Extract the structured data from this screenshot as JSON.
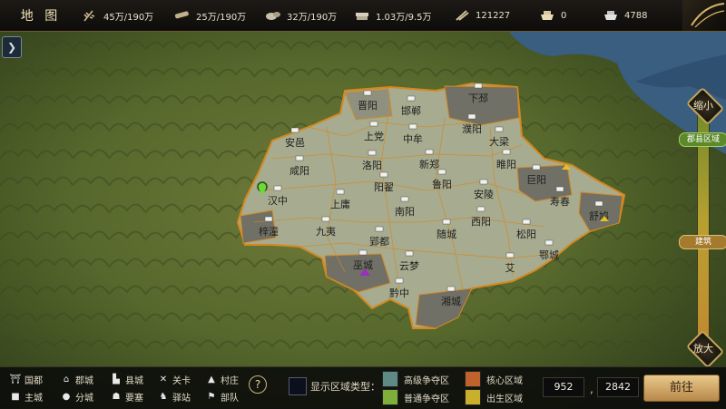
{
  "topbar": {
    "title": "地 图",
    "resources": [
      {
        "icon": "wheat-icon",
        "value": "45万/190万"
      },
      {
        "icon": "wood-icon",
        "value": "25万/190万"
      },
      {
        "icon": "stone-icon",
        "value": "32万/190万"
      },
      {
        "icon": "iron-icon",
        "value": "1.03万/9.5万"
      },
      {
        "icon": "copper-coin-icon",
        "value": "121227"
      },
      {
        "icon": "gold-ingot-icon",
        "value": "0"
      },
      {
        "icon": "silver-ingot-icon",
        "value": "4788"
      }
    ]
  },
  "zoom": {
    "shrink_label": "缩小",
    "enlarge_label": "放大",
    "district_level": "郡县区域",
    "building_level": "建筑"
  },
  "map": {
    "labels": [
      "晋阳",
      "邯郸",
      "下邳",
      "安邑",
      "上党",
      "中牟",
      "濮阳",
      "大梁",
      "咸阳",
      "洛阳",
      "新郑",
      "睢阳",
      "巨阳",
      "阳翟",
      "鲁阳",
      "安陵",
      "汉中",
      "上庸",
      "南阳",
      "寿春",
      "舒鸠",
      "梓潼",
      "九夷",
      "郢都",
      "随城",
      "西阳",
      "松阳",
      "巫城",
      "云梦",
      "艾",
      "鄂城",
      "黔中",
      "湘城"
    ]
  },
  "legend": {
    "items": [
      {
        "icon": "capital-icon",
        "label": "国都"
      },
      {
        "icon": "commandery-icon",
        "label": "郡城"
      },
      {
        "icon": "county-icon",
        "label": "县城"
      },
      {
        "icon": "pass-icon",
        "label": "关卡"
      },
      {
        "icon": "village-icon",
        "label": "村庄"
      },
      {
        "icon": "main-city-icon",
        "label": "主城"
      },
      {
        "icon": "branch-city-icon",
        "label": "分城"
      },
      {
        "icon": "fortress-icon",
        "label": "要塞"
      },
      {
        "icon": "post-station-icon",
        "label": "驿站"
      },
      {
        "icon": "troop-icon",
        "label": "部队"
      }
    ],
    "show_type_label": "显示区域类型：",
    "zones": [
      {
        "label": "高级争夺区",
        "color": "#5e8a86"
      },
      {
        "label": "核心区域",
        "color": "#c0622e"
      },
      {
        "label": "普通争夺区",
        "color": "#7fae3a"
      },
      {
        "label": "出生区域",
        "color": "#c8b02c"
      }
    ]
  },
  "coords": {
    "x": "952",
    "y": "2842",
    "goto_label": "前往"
  }
}
